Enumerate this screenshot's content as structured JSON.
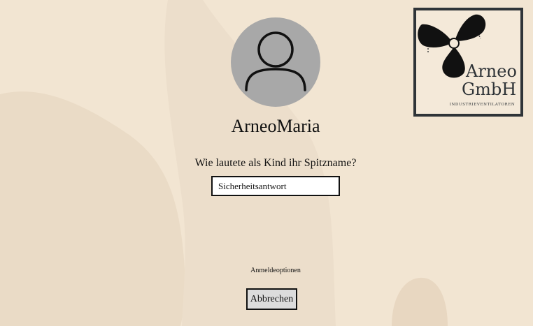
{
  "account": {
    "username": "ArneoMaria"
  },
  "security_question": {
    "question": "Wie lautete als Kind ihr Spitzname?",
    "answer_placeholder": "Sicherheitsantwort",
    "answer_value": ""
  },
  "links": {
    "signin_options": "Anmeldeoptionen"
  },
  "buttons": {
    "cancel": "Abbrechen"
  },
  "logo": {
    "line1": "Arneo",
    "line2": "GmbH",
    "tagline": "INDUSTRIEVENTILATOREN",
    "icon": "propeller-icon"
  },
  "colors": {
    "background": "#f2e5d2",
    "avatar": "#a8a8a8",
    "logo_frame": "#2f3438"
  }
}
